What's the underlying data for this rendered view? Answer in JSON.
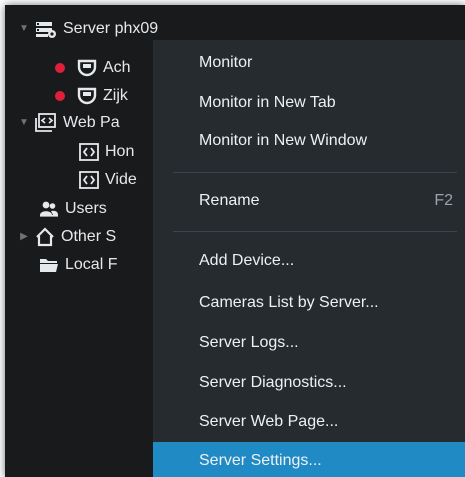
{
  "tree": {
    "server": "Server phx09",
    "camera1": "Ach",
    "camera2": "Zijk",
    "webpages": "Web Pa",
    "webpage1": "Hon",
    "webpage2": "Vide",
    "users": "Users",
    "other": "Other S",
    "local": "Local F"
  },
  "menu": {
    "monitor": "Monitor",
    "monitor_new_tab": "Monitor in New Tab",
    "monitor_new_window": "Monitor in New Window",
    "rename": "Rename",
    "rename_shortcut": "F2",
    "add_device": "Add Device...",
    "cameras_list": "Cameras List by Server...",
    "server_logs": "Server Logs...",
    "server_diagnostics": "Server Diagnostics...",
    "server_web_page": "Server Web Page...",
    "server_settings": "Server Settings..."
  },
  "colors": {
    "background": "#181a1c",
    "menu_background": "#252b2f",
    "highlight": "#1f8ac4",
    "status_dot": "#e0203a"
  }
}
